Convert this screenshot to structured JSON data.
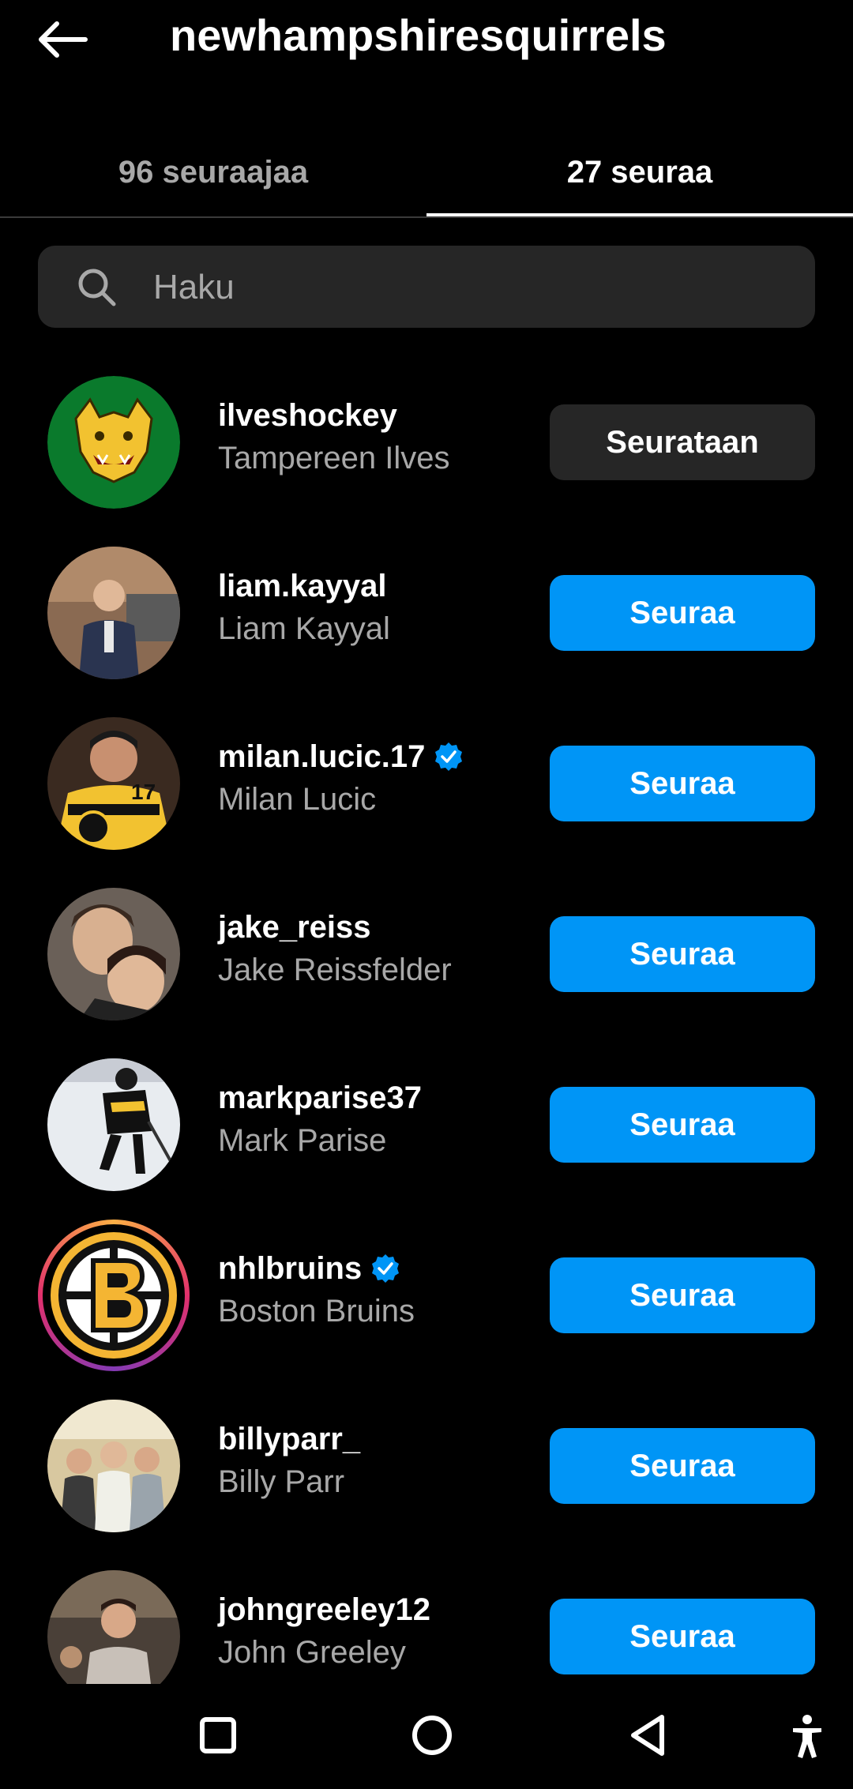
{
  "header": {
    "title": "newhampshiresquirrels",
    "back_icon": "arrow-left-icon"
  },
  "tabs": [
    {
      "label": "96 seuraajaa",
      "active": false
    },
    {
      "label": "27 seuraa",
      "active": true
    }
  ],
  "search": {
    "placeholder": "Haku",
    "value": ""
  },
  "colors": {
    "accent": "#0095f6",
    "background": "#000000",
    "secondary_button": "#262626",
    "muted_text": "#a8a8a8"
  },
  "list": [
    {
      "username": "ilveshockey",
      "fullname": "Tampereen Ilves",
      "verified": false,
      "button": "Seurataan",
      "button_style": "following"
    },
    {
      "username": "liam.kayyal",
      "fullname": "Liam Kayyal",
      "verified": false,
      "button": "Seuraa",
      "button_style": "follow"
    },
    {
      "username": "milan.lucic.17",
      "fullname": "Milan Lucic",
      "verified": true,
      "button": "Seuraa",
      "button_style": "follow"
    },
    {
      "username": "jake_reiss",
      "fullname": "Jake Reissfelder",
      "verified": false,
      "button": "Seuraa",
      "button_style": "follow"
    },
    {
      "username": "markparise37",
      "fullname": "Mark Parise",
      "verified": false,
      "button": "Seuraa",
      "button_style": "follow"
    },
    {
      "username": "nhlbruins",
      "fullname": "Boston Bruins",
      "verified": true,
      "button": "Seuraa",
      "button_style": "follow"
    },
    {
      "username": "billyparr_",
      "fullname": "Billy Parr",
      "verified": false,
      "button": "Seuraa",
      "button_style": "follow"
    },
    {
      "username": "johngreeley12",
      "fullname": "John Greeley",
      "verified": false,
      "button": "Seuraa",
      "button_style": "follow"
    }
  ],
  "navbar": {
    "icons": [
      "recent-apps-icon",
      "home-icon",
      "back-icon",
      "accessibility-icon"
    ]
  }
}
